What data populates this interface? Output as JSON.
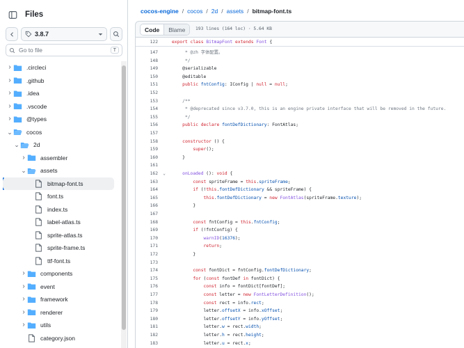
{
  "sidebar": {
    "title": "Files",
    "branch": "3.8.7",
    "goto_placeholder": "Go to file",
    "goto_shortcut": "T",
    "tree": [
      {
        "name": ".circleci",
        "kind": "folder",
        "depth": 0,
        "expanded": false
      },
      {
        "name": ".github",
        "kind": "folder",
        "depth": 0,
        "expanded": false
      },
      {
        "name": ".idea",
        "kind": "folder",
        "depth": 0,
        "expanded": false
      },
      {
        "name": ".vscode",
        "kind": "folder",
        "depth": 0,
        "expanded": false
      },
      {
        "name": "@types",
        "kind": "folder",
        "depth": 0,
        "expanded": false
      },
      {
        "name": "cocos",
        "kind": "folder",
        "depth": 0,
        "expanded": true
      },
      {
        "name": "2d",
        "kind": "folder",
        "depth": 1,
        "expanded": true
      },
      {
        "name": "assembler",
        "kind": "folder",
        "depth": 2,
        "expanded": false
      },
      {
        "name": "assets",
        "kind": "folder",
        "depth": 2,
        "expanded": true
      },
      {
        "name": "bitmap-font.ts",
        "kind": "file",
        "depth": 3,
        "active": true
      },
      {
        "name": "font.ts",
        "kind": "file",
        "depth": 3
      },
      {
        "name": "index.ts",
        "kind": "file",
        "depth": 3
      },
      {
        "name": "label-atlas.ts",
        "kind": "file",
        "depth": 3
      },
      {
        "name": "sprite-atlas.ts",
        "kind": "file",
        "depth": 3
      },
      {
        "name": "sprite-frame.ts",
        "kind": "file",
        "depth": 3
      },
      {
        "name": "ttf-font.ts",
        "kind": "file",
        "depth": 3
      },
      {
        "name": "components",
        "kind": "folder",
        "depth": 2,
        "expanded": false
      },
      {
        "name": "event",
        "kind": "folder",
        "depth": 2,
        "expanded": false
      },
      {
        "name": "framework",
        "kind": "folder",
        "depth": 2,
        "expanded": false
      },
      {
        "name": "renderer",
        "kind": "folder",
        "depth": 2,
        "expanded": false
      },
      {
        "name": "utils",
        "kind": "folder",
        "depth": 2,
        "expanded": false
      },
      {
        "name": "category.json",
        "kind": "file",
        "depth": 2
      }
    ]
  },
  "breadcrumb": [
    "cocos-engine",
    "cocos",
    "2d",
    "assets",
    "bitmap-font.ts"
  ],
  "file": {
    "tab_code": "Code",
    "tab_blame": "Blame",
    "info": "193 lines (164 loc) · 5.64 KB"
  },
  "code": {
    "sticky_line": {
      "num": "122",
      "html": "<span class=\"k\">export</span> <span class=\"k\">class</span> <span class=\"f\">BitmapFont</span> <span class=\"k\">extends</span> <span class=\"f\">Font</span> {"
    },
    "lines": [
      {
        "num": "147",
        "html": "     <span class=\"c\">* @zh 字体配置。</span>"
      },
      {
        "num": "148",
        "html": "     <span class=\"c\">*/</span>"
      },
      {
        "num": "149",
        "html": "    @serializable"
      },
      {
        "num": "150",
        "html": "    @editable"
      },
      {
        "num": "151",
        "html": "    <span class=\"k\">public</span> <span class=\"p\">fntConfig</span>: IConfig | <span class=\"k\">null</span> = <span class=\"k\">null</span>;"
      },
      {
        "num": "152",
        "html": ""
      },
      {
        "num": "153",
        "html": "    <span class=\"c\">/**</span>"
      },
      {
        "num": "154",
        "html": "     <span class=\"c\">* @deprecated since v3.7.0, this is an engine private interface that will be removed in the future.</span>"
      },
      {
        "num": "155",
        "html": "     <span class=\"c\">*/</span>"
      },
      {
        "num": "156",
        "html": "    <span class=\"k\">public</span> <span class=\"k\">declare</span> <span class=\"p\">fontDefDictionary</span>: FontAtlas;"
      },
      {
        "num": "157",
        "html": ""
      },
      {
        "num": "158",
        "html": "    <span class=\"k\">constructor</span> () {"
      },
      {
        "num": "159",
        "html": "        <span class=\"k\">super</span>();"
      },
      {
        "num": "160",
        "html": "    }"
      },
      {
        "num": "161",
        "html": ""
      },
      {
        "num": "162",
        "html": "    <span class=\"f\">onLoaded</span> (): <span class=\"k\">void</span> {",
        "fold": true
      },
      {
        "num": "163",
        "html": "        <span class=\"k\">const</span> spriteFrame = <span class=\"k\">this</span>.<span class=\"p\">spriteFrame</span>;"
      },
      {
        "num": "164",
        "html": "        <span class=\"k\">if</span> (!<span class=\"k\">this</span>.<span class=\"p\">fontDefDictionary</span> &amp;&amp; spriteFrame) {"
      },
      {
        "num": "165",
        "html": "            <span class=\"k\">this</span>.<span class=\"p\">fontDefDictionary</span> = <span class=\"k\">new</span> <span class=\"f\">FontAtlas</span>(spriteFrame.<span class=\"p\">texture</span>);"
      },
      {
        "num": "166",
        "html": "        }"
      },
      {
        "num": "167",
        "html": ""
      },
      {
        "num": "168",
        "html": "        <span class=\"k\">const</span> fntConfig = <span class=\"k\">this</span>.<span class=\"p\">fntConfig</span>;"
      },
      {
        "num": "169",
        "html": "        <span class=\"k\">if</span> (!fntConfig) {"
      },
      {
        "num": "170",
        "html": "            <span class=\"f\">warnID</span>(<span class=\"p\">16376</span>);"
      },
      {
        "num": "171",
        "html": "            <span class=\"k\">return</span>;"
      },
      {
        "num": "172",
        "html": "        }"
      },
      {
        "num": "173",
        "html": ""
      },
      {
        "num": "174",
        "html": "        <span class=\"k\">const</span> fontDict = fntConfig.<span class=\"p\">fontDefDictionary</span>;"
      },
      {
        "num": "175",
        "html": "        <span class=\"k\">for</span> (<span class=\"k\">const</span> fontDef <span class=\"k\">in</span> fontDict) {"
      },
      {
        "num": "176",
        "html": "            <span class=\"k\">const</span> info = fontDict[fontDef];"
      },
      {
        "num": "177",
        "html": "            <span class=\"k\">const</span> letter = <span class=\"k\">new</span> <span class=\"f\">FontLetterDefinition</span>();"
      },
      {
        "num": "178",
        "html": "            <span class=\"k\">const</span> rect = info.<span class=\"p\">rect</span>;"
      },
      {
        "num": "179",
        "html": "            letter.<span class=\"p\">offsetX</span> = info.<span class=\"p\">xOffset</span>;"
      },
      {
        "num": "180",
        "html": "            letter.<span class=\"p\">offsetY</span> = info.<span class=\"p\">yOffset</span>;"
      },
      {
        "num": "181",
        "html": "            letter.<span class=\"p\">w</span> = rect.<span class=\"p\">width</span>;"
      },
      {
        "num": "182",
        "html": "            letter.<span class=\"p\">h</span> = rect.<span class=\"p\">height</span>;"
      },
      {
        "num": "183",
        "html": "            letter.<span class=\"p\">u</span> = rect.<span class=\"p\">x</span>;"
      },
      {
        "num": "184",
        "html": "            letter.<span class=\"p\">v</span> = rect.<span class=\"p\">y</span>;"
      }
    ]
  }
}
